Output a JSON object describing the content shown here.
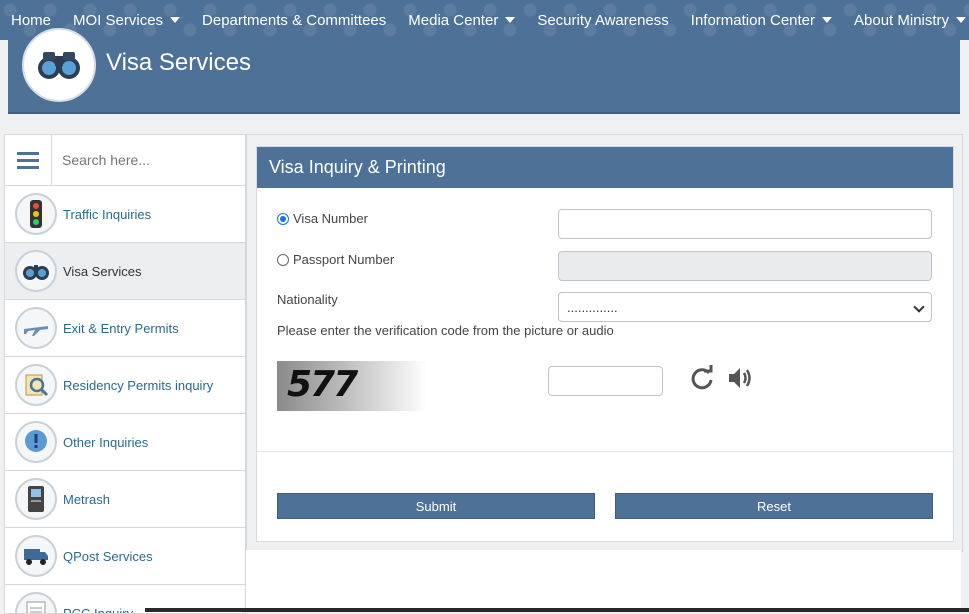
{
  "nav": {
    "items": [
      {
        "label": "Home",
        "dropdown": false
      },
      {
        "label": "MOI Services",
        "dropdown": true
      },
      {
        "label": "Departments & Committees",
        "dropdown": false
      },
      {
        "label": "Media Center",
        "dropdown": true
      },
      {
        "label": "Security Awareness",
        "dropdown": false
      },
      {
        "label": "Information Center",
        "dropdown": true
      },
      {
        "label": "About Ministry",
        "dropdown": true
      }
    ]
  },
  "banner": {
    "title": "Visa Services",
    "icon": "binoculars-icon"
  },
  "sidebar": {
    "search_placeholder": "Search here...",
    "items": [
      {
        "label": "Traffic Inquiries",
        "icon": "traffic-light-icon"
      },
      {
        "label": "Visa Services",
        "icon": "binoculars-icon",
        "active": true
      },
      {
        "label": "Exit & Entry Permits",
        "icon": "airplane-icon"
      },
      {
        "label": "Residency Permits inquiry",
        "icon": "magnifier-document-icon"
      },
      {
        "label": "Other Inquiries",
        "icon": "info-bubble-icon"
      },
      {
        "label": "Metrash",
        "icon": "kiosk-icon"
      },
      {
        "label": "QPost Services",
        "icon": "delivery-truck-icon"
      },
      {
        "label": "PCC Inquiry",
        "icon": "certificate-icon"
      }
    ]
  },
  "form": {
    "title": "Visa Inquiry & Printing",
    "visa_number_label": "Visa Number",
    "passport_number_label": "Passport Number",
    "nationality_label": "Nationality",
    "nationality_selected": "..............",
    "verification_text": "Please enter the verification code from the picture or audio",
    "captcha_text": "577",
    "submit_label": "Submit",
    "reset_label": "Reset",
    "selected_option": "visa_number"
  },
  "colors": {
    "primary": "#4e7198",
    "link": "#2b6a8f"
  }
}
